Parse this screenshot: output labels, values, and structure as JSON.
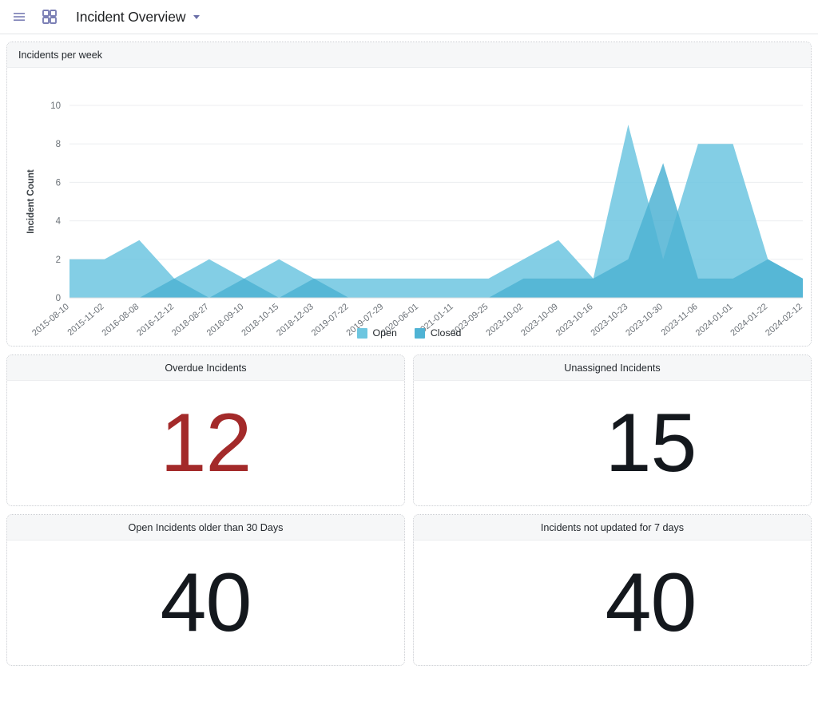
{
  "appbar": {
    "menu_icon": "hamburger-icon",
    "apps_icon": "grid-icon",
    "title": "Incident Overview",
    "caret_icon": "chevron-down-icon"
  },
  "chart_card": {
    "title": "Incidents per week"
  },
  "chart_data": {
    "type": "area",
    "title": "Incidents per week",
    "xlabel": "",
    "ylabel": "Incident Count",
    "ylim": [
      0,
      10
    ],
    "yticks": [
      0,
      2,
      4,
      6,
      8,
      10
    ],
    "grid": true,
    "legend_position": "bottom",
    "stacked": false,
    "categories": [
      "2015-08-10",
      "2015-11-02",
      "2016-08-08",
      "2016-12-12",
      "2018-08-27",
      "2018-09-10",
      "2018-10-15",
      "2018-12-03",
      "2019-07-22",
      "2019-07-29",
      "2020-06-01",
      "2021-01-11",
      "2023-09-25",
      "2023-10-02",
      "2023-10-09",
      "2023-10-16",
      "2023-10-23",
      "2023-10-30",
      "2023-11-06",
      "2024-01-01",
      "2024-01-22",
      "2024-02-12"
    ],
    "series": [
      {
        "name": "Open",
        "color": "#6dc6e0",
        "values": [
          2,
          2,
          3,
          1,
          2,
          1,
          2,
          1,
          1,
          1,
          1,
          1,
          1,
          2,
          3,
          1,
          9,
          2,
          8,
          8,
          2,
          1
        ]
      },
      {
        "name": "Closed",
        "color": "#4fb3d4",
        "values": [
          0,
          0,
          0,
          1,
          0,
          1,
          0,
          1,
          0,
          0,
          0,
          0,
          0,
          1,
          1,
          1,
          2,
          7,
          1,
          1,
          2,
          1
        ]
      }
    ],
    "colors": {
      "open": "#6dc6e0",
      "closed": "#4fb3d4",
      "overlap": "#5bbcdc",
      "gridline": "#eceef0",
      "axis_text": "#6b7177"
    }
  },
  "legend": {
    "items": [
      {
        "label": "Open",
        "color": "#6dc6e0"
      },
      {
        "label": "Closed",
        "color": "#4fb3d4"
      }
    ]
  },
  "kpis": {
    "overdue": {
      "title": "Overdue Incidents",
      "value": "12",
      "color": "#a32a2a"
    },
    "unassigned": {
      "title": "Unassigned Incidents",
      "value": "15",
      "color": "#14181d"
    },
    "older_30days": {
      "title": "Open Incidents older than 30 Days",
      "value": "40",
      "color": "#14181d"
    },
    "not_updated": {
      "title": "Incidents not updated for 7 days",
      "value": "40",
      "color": "#14181d"
    }
  }
}
